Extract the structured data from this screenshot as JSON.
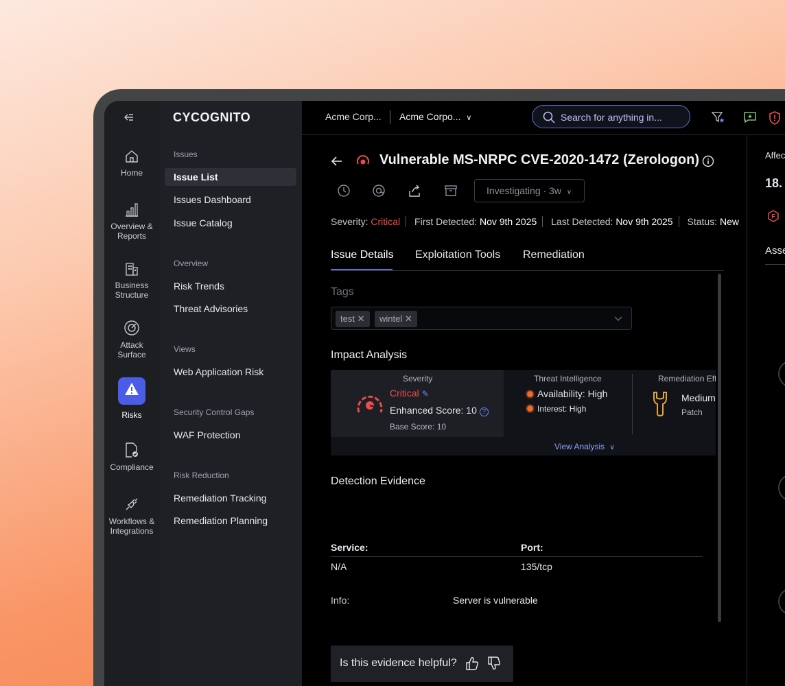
{
  "topbar": {
    "org_primary": "Acme Corp...",
    "org_secondary": "Acme Corpo...",
    "search_placeholder": "Search for anything in..."
  },
  "brand": "CYCOGNITO",
  "rail": {
    "home": "Home",
    "overview_l1": "Overview &",
    "overview_l2": "Reports",
    "business_l1": "Business",
    "business_l2": "Structure",
    "attack_l1": "Attack",
    "attack_l2": "Surface",
    "risks": "Risks",
    "compliance": "Compliance",
    "workflows_l1": "Workflows &",
    "workflows_l2": "Integrations"
  },
  "nav": {
    "sec_issues": "Issues",
    "issue_list": "Issue List",
    "issues_dashboard": "Issues Dashboard",
    "issue_catalog": "Issue Catalog",
    "sec_overview": "Overview",
    "risk_trends": "Risk Trends",
    "threat_advisories": "Threat Advisories",
    "sec_views": "Views",
    "web_app_risk": "Web Application Risk",
    "sec_scg": "Security Control Gaps",
    "waf_protection": "WAF Protection",
    "sec_risk_reduction": "Risk Reduction",
    "remediation_tracking": "Remediation Tracking",
    "remediation_planning": "Remediation Planning"
  },
  "issue": {
    "title": "Vulnerable MS-NRPC CVE-2020-1472 (Zerologon)",
    "status_dropdown": "Investigating · 3w",
    "severity_label": "Severity:",
    "severity_value": "Critical",
    "first_detected_label": "First Detected:",
    "first_detected_value": "Nov 9th 2025",
    "last_detected_label": "Last Detected:",
    "last_detected_value": "Nov 9th 2025",
    "status_label": "Status:",
    "status_value": "New"
  },
  "tabs": [
    "Issue Details",
    "Exploitation Tools",
    "Remediation"
  ],
  "tags": {
    "label": "Tags",
    "items": [
      "test",
      "wintel"
    ]
  },
  "impact": {
    "heading": "Impact Analysis",
    "severity_caption": "Severity",
    "severity_value": "Critical",
    "enhanced_score": "Enhanced Score: 10",
    "base_score": "Base Score: 10",
    "threat_caption": "Threat Intelligence",
    "availability_label": "Availability:",
    "availability_value": "High",
    "interest_label": "Interest:",
    "interest_value": "High",
    "remediation_caption": "Remediation Eff",
    "remediation_value": "Medium",
    "remediation_type": "Patch",
    "view_analysis": "View Analysis"
  },
  "evidence": {
    "heading": "Detection Evidence",
    "service_label": "Service:",
    "service_value": "N/A",
    "port_label": "Port:",
    "port_value": "135/tcp",
    "info_label": "Info:",
    "info_value": "Server is vulnerable",
    "helpful_question": "Is this evidence helpful?"
  },
  "right_panel": {
    "affected_label": "Affec",
    "ip_partial": "18.",
    "assets_label": "Asse"
  },
  "colors": {
    "accent": "#4b5de8",
    "critical": "#ee4b4b",
    "orange": "#ee6b2d",
    "remediation_icon": "#e8a43c"
  }
}
